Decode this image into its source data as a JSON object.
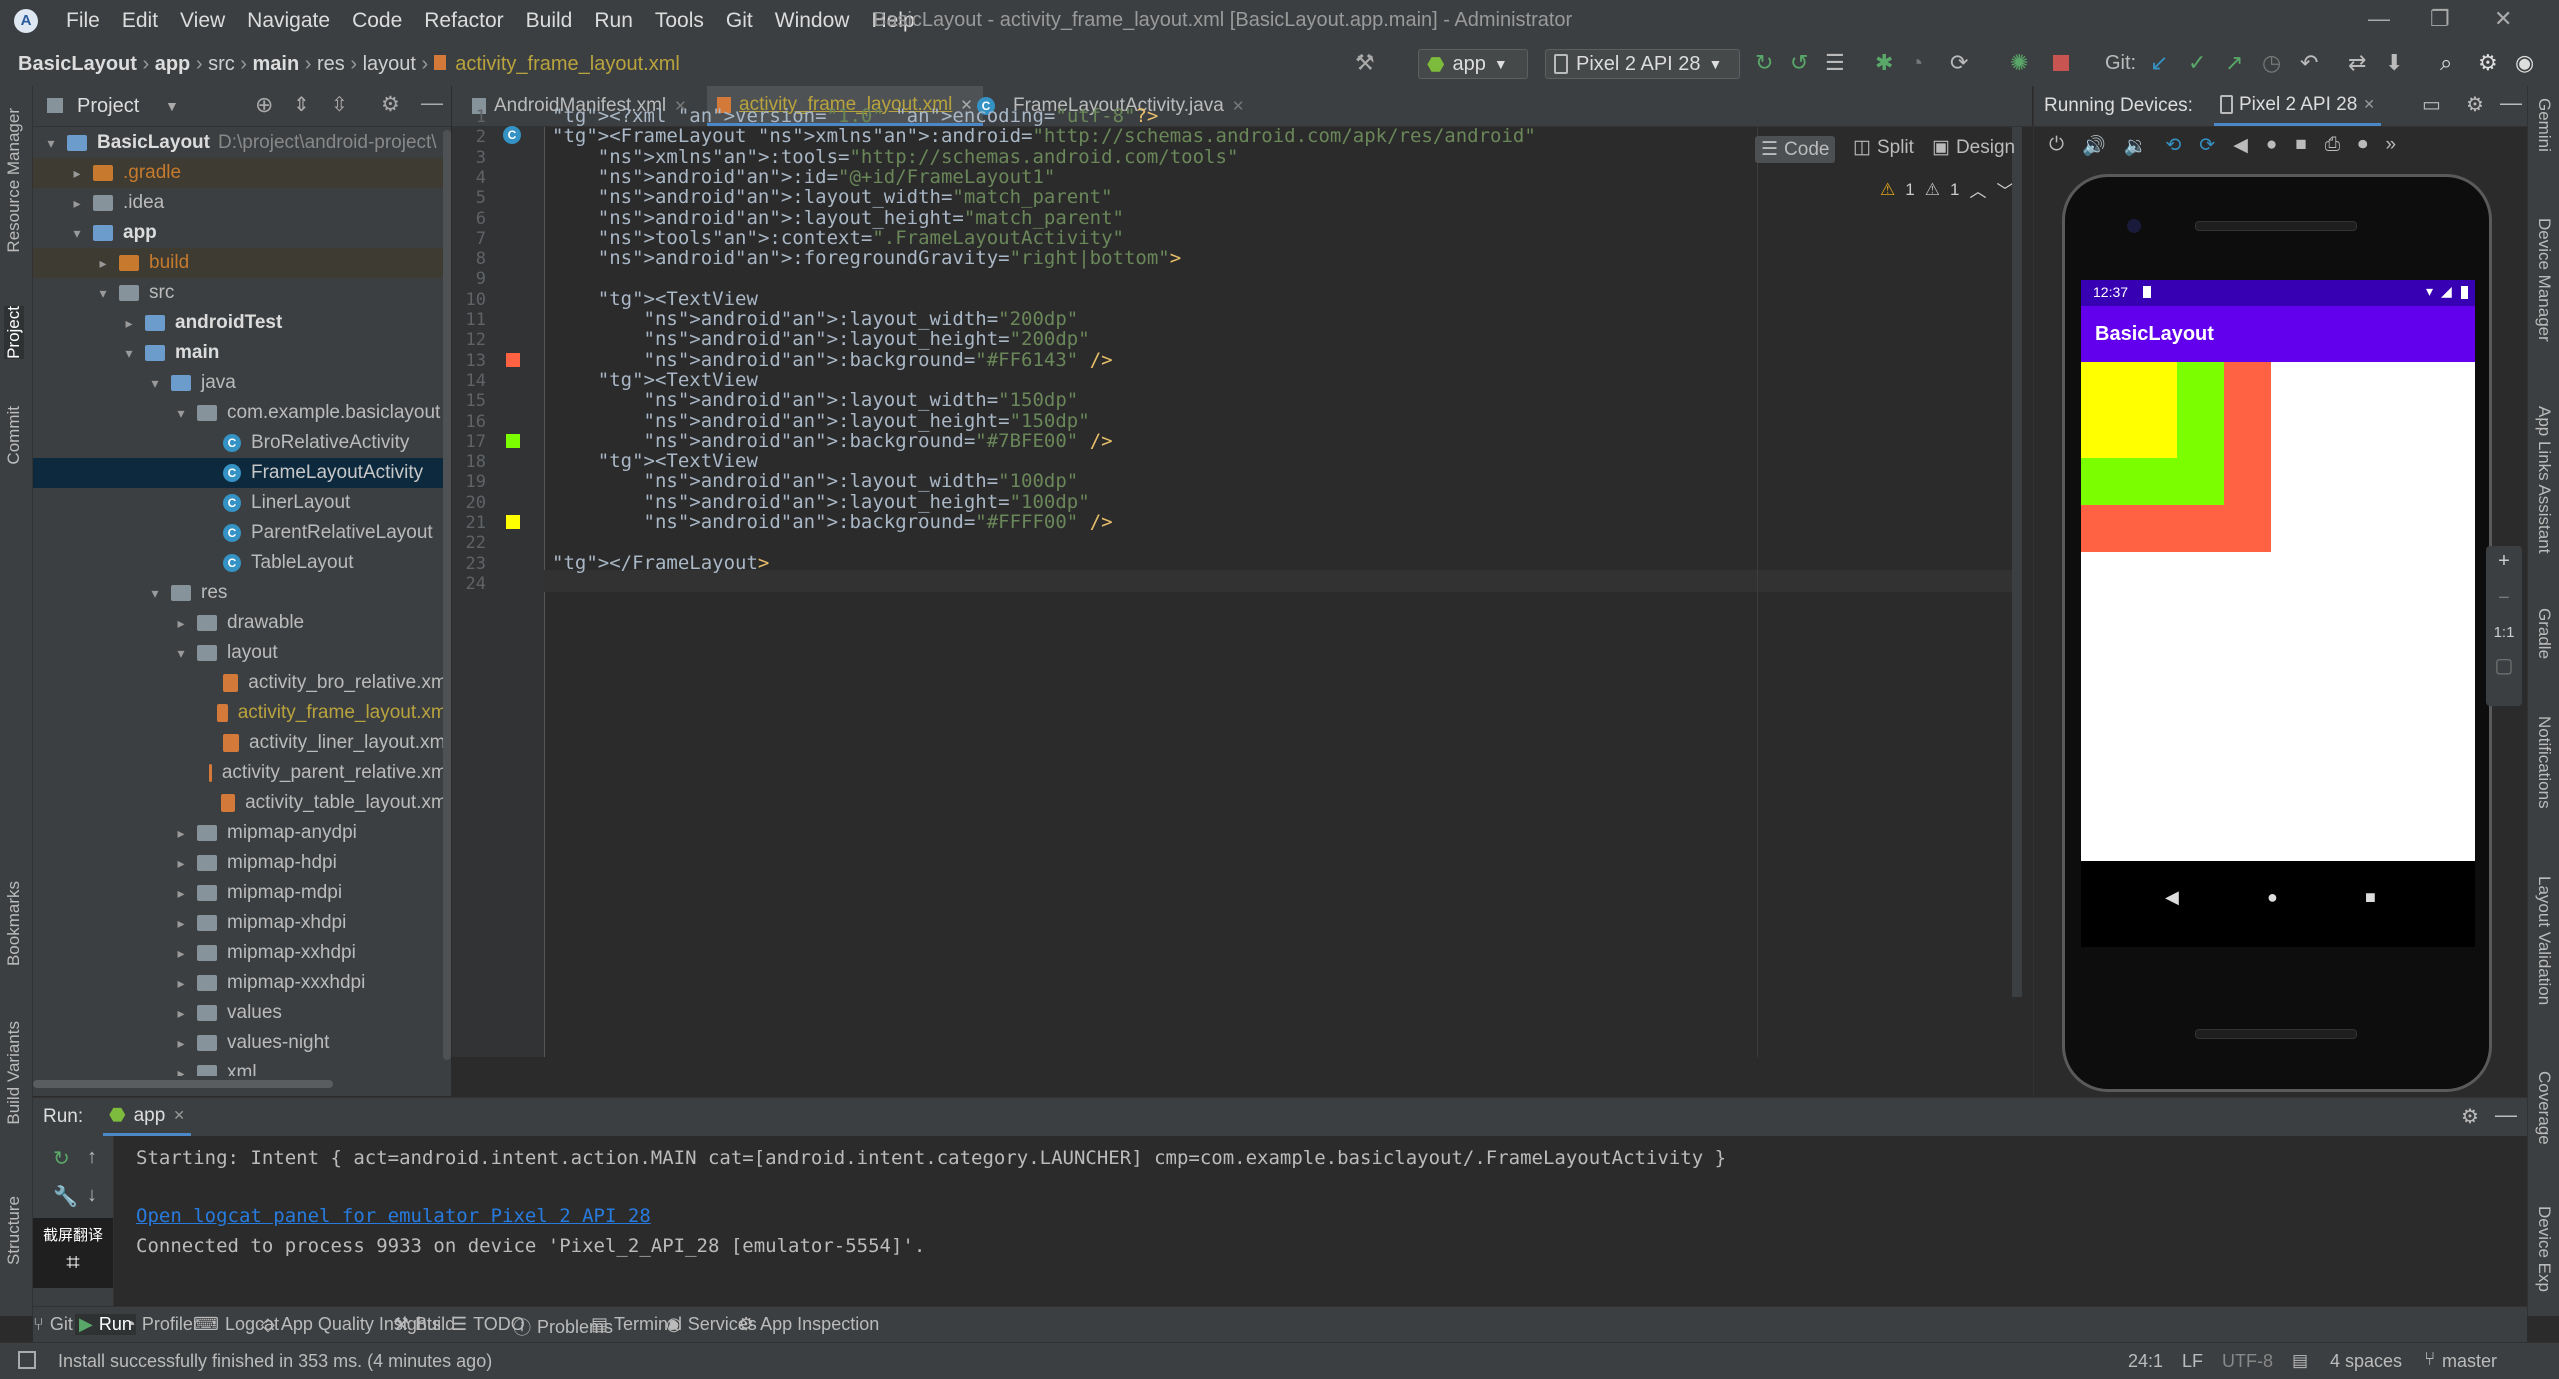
{
  "window": {
    "title": "BasicLayout - activity_frame_layout.xml [BasicLayout.app.main] - Administrator",
    "menu": [
      "File",
      "Edit",
      "View",
      "Navigate",
      "Code",
      "Refactor",
      "Build",
      "Run",
      "Tools",
      "Git",
      "Window",
      "Help"
    ]
  },
  "breadcrumb": {
    "items": [
      "BasicLayout",
      "app",
      "src",
      "main",
      "res",
      "layout"
    ],
    "file": "activity_frame_layout.xml"
  },
  "toolbar": {
    "run_config": "app",
    "device": "Pixel 2 API 28",
    "git_label": "Git:"
  },
  "left_strip": {
    "resource_manager": "Resource Manager",
    "project": "Project",
    "commit": "Commit",
    "bookmarks": "Bookmarks",
    "build_variants": "Build Variants",
    "structure": "Structure"
  },
  "right_strip": {
    "gemini": "Gemini",
    "device_manager": "Device Manager",
    "app_links": "App Links Assistant",
    "gradle": "Gradle",
    "notifications": "Notifications",
    "layout_validation": "Layout Validation",
    "coverage": "Coverage",
    "device_explorer": "Device Exp"
  },
  "project_panel": {
    "title": "Project",
    "root_name": "BasicLayout",
    "root_path": "D:\\project\\android-project\\",
    "tree": [
      {
        "label": "BasicLayout",
        "level": 0,
        "arrow": "▾",
        "icon": "fold-blue"
      },
      {
        "label": ".gradle",
        "level": 1,
        "arrow": "▸",
        "icon": "fold-orange",
        "muted": true
      },
      {
        "label": ".idea",
        "level": 1,
        "arrow": "▸",
        "icon": "fold"
      },
      {
        "label": "app",
        "level": 1,
        "arrow": "▾",
        "icon": "fold-blue",
        "bold": true
      },
      {
        "label": "build",
        "level": 2,
        "arrow": "▸",
        "icon": "fold-orange",
        "muted": true
      },
      {
        "label": "src",
        "level": 2,
        "arrow": "▾",
        "icon": "fold"
      },
      {
        "label": "androidTest",
        "level": 3,
        "arrow": "▸",
        "icon": "fold-blue",
        "bold": true
      },
      {
        "label": "main",
        "level": 3,
        "arrow": "▾",
        "icon": "fold-blue",
        "bold": true
      },
      {
        "label": "java",
        "level": 4,
        "arrow": "▾",
        "icon": "fold-blue"
      },
      {
        "label": "com.example.basiclayout",
        "level": 5,
        "arrow": "▾",
        "icon": "fold"
      },
      {
        "label": "BroRelativeActivity",
        "level": 6,
        "arrow": "",
        "icon": "class"
      },
      {
        "label": "FrameLayoutActivity",
        "level": 6,
        "arrow": "",
        "icon": "class",
        "selected": true
      },
      {
        "label": "LinerLayout",
        "level": 6,
        "arrow": "",
        "icon": "class"
      },
      {
        "label": "ParentRelativeLayout",
        "level": 6,
        "arrow": "",
        "icon": "class"
      },
      {
        "label": "TableLayout",
        "level": 6,
        "arrow": "",
        "icon": "class"
      },
      {
        "label": "res",
        "level": 4,
        "arrow": "▾",
        "icon": "fold"
      },
      {
        "label": "drawable",
        "level": 5,
        "arrow": "▸",
        "icon": "fold"
      },
      {
        "label": "layout",
        "level": 5,
        "arrow": "▾",
        "icon": "fold"
      },
      {
        "label": "activity_bro_relative.xml",
        "level": 6,
        "arrow": "",
        "icon": "xml"
      },
      {
        "label": "activity_frame_layout.xml",
        "level": 6,
        "arrow": "",
        "icon": "xml",
        "highlight": true
      },
      {
        "label": "activity_liner_layout.xml",
        "level": 6,
        "arrow": "",
        "icon": "xml"
      },
      {
        "label": "activity_parent_relative.xml",
        "level": 6,
        "arrow": "",
        "icon": "xml"
      },
      {
        "label": "activity_table_layout.xml",
        "level": 6,
        "arrow": "",
        "icon": "xml"
      },
      {
        "label": "mipmap-anydpi",
        "level": 5,
        "arrow": "▸",
        "icon": "fold"
      },
      {
        "label": "mipmap-hdpi",
        "level": 5,
        "arrow": "▸",
        "icon": "fold"
      },
      {
        "label": "mipmap-mdpi",
        "level": 5,
        "arrow": "▸",
        "icon": "fold"
      },
      {
        "label": "mipmap-xhdpi",
        "level": 5,
        "arrow": "▸",
        "icon": "fold"
      },
      {
        "label": "mipmap-xxhdpi",
        "level": 5,
        "arrow": "▸",
        "icon": "fold"
      },
      {
        "label": "mipmap-xxxhdpi",
        "level": 5,
        "arrow": "▸",
        "icon": "fold"
      },
      {
        "label": "values",
        "level": 5,
        "arrow": "▸",
        "icon": "fold"
      },
      {
        "label": "values-night",
        "level": 5,
        "arrow": "▸",
        "icon": "fold"
      },
      {
        "label": "xml",
        "level": 5,
        "arrow": "▸",
        "icon": "fold"
      }
    ]
  },
  "editor_tabs": [
    {
      "label": "AndroidManifest.xml",
      "active": false
    },
    {
      "label": "activity_frame_layout.xml",
      "active": true
    },
    {
      "label": "FrameLayoutActivity.java",
      "active": false
    }
  ],
  "editor_modes": {
    "code": "Code",
    "split": "Split",
    "design": "Design"
  },
  "inspection": {
    "warnings": "1",
    "weak_warnings": "1"
  },
  "code_lines": [
    "<?xml version=\"1.0\" encoding=\"utf-8\"?>",
    "<FrameLayout xmlns:android=\"http://schemas.android.com/apk/res/android\"",
    "    xmlns:tools=\"http://schemas.android.com/tools\"",
    "    android:id=\"@+id/FrameLayout1\"",
    "    android:layout_width=\"match_parent\"",
    "    android:layout_height=\"match_parent\"",
    "    tools:context=\".FrameLayoutActivity\"",
    "    android:foregroundGravity=\"right|bottom\">",
    "",
    "    <TextView",
    "        android:layout_width=\"200dp\"",
    "        android:layout_height=\"200dp\"",
    "        android:background=\"#FF6143\" />",
    "    <TextView",
    "        android:layout_width=\"150dp\"",
    "        android:layout_height=\"150dp\"",
    "        android:background=\"#7BFE00\" />",
    "    <TextView",
    "        android:layout_width=\"100dp\"",
    "        android:layout_height=\"100dp\"",
    "        android:background=\"#FFFF00\" />",
    "",
    "</FrameLayout>",
    ""
  ],
  "colors": {
    "red": "#FF6143",
    "green": "#7BFE00",
    "yellow": "#FFFF00",
    "app_bar": "#6200ee",
    "status_bar": "#3700b3"
  },
  "running_devices": {
    "title": "Running Devices:",
    "device_tab": "Pixel 2 API 28",
    "status_time": "12:37",
    "app_title": "BasicLayout",
    "zoom_ratio": "1:1",
    "zoom_in": "+",
    "zoom_out": "−"
  },
  "run_panel": {
    "label": "Run:",
    "config": "app",
    "lines": [
      "Starting: Intent { act=android.intent.action.MAIN cat=[android.intent.category.LAUNCHER] cmp=com.example.basiclayout/.FrameLayoutActivity }",
      "",
      "Open logcat panel for emulator Pixel 2 API 28",
      "Connected to process 9933 on device 'Pixel_2_API_28 [emulator-5554]'."
    ],
    "overlay_label": "截屏翻译"
  },
  "bottom_tools": [
    "Git",
    "Run",
    "Profiler",
    "Logcat",
    "App Quality Insights",
    "Build",
    "TODO",
    "Problems",
    "Terminal",
    "Services",
    "App Inspection"
  ],
  "status_bar": {
    "message": "Install successfully finished in 353 ms. (4 minutes ago)",
    "position": "24:1",
    "line_sep": "LF",
    "encoding": "UTF-8",
    "indent": "4 spaces",
    "branch": "master"
  }
}
